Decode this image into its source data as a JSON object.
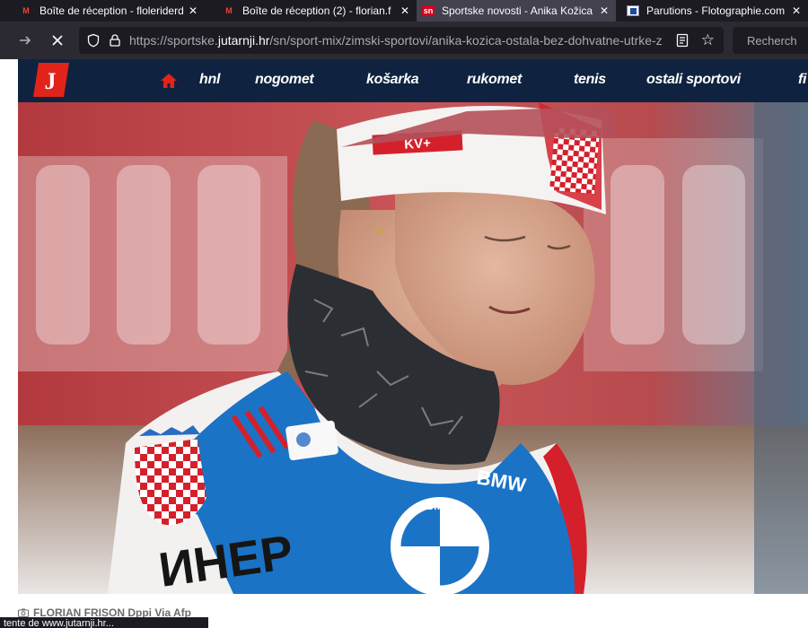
{
  "browser": {
    "tabs": [
      {
        "title": "Boîte de réception - floleriderdu",
        "favicon": "gmail-icon",
        "active": false
      },
      {
        "title": "Boîte de réception (2) - florian.f",
        "favicon": "gmail-icon",
        "active": false
      },
      {
        "title": "Sportske novosti - Anika Kožica",
        "favicon": "sn-icon",
        "favicon_text": "sn",
        "active": true
      },
      {
        "title": "Parutions - Flotographie.com",
        "favicon": "flotographie-icon",
        "active": false
      }
    ],
    "url_prefix": "https://sportske.",
    "url_domain": "jutarnji.hr",
    "url_path": "/sn/sport-mix/zimski-sportovi/anika-kozica-ostala-bez-dohvatne-utrke-z",
    "search_placeholder": "Recherch",
    "status_text": "tente de www.jutarnji.hr..."
  },
  "site": {
    "logo_text": "J",
    "nav": [
      "hnl",
      "nogomet",
      "košarka",
      "rukomet",
      "tenis",
      "ostali sportovi",
      "fi"
    ],
    "photo": {
      "bib_text": "ИHEP",
      "bmw_text": "BMW",
      "headband_text": "KV+"
    },
    "caption": "FLORIAN FRISON Dppi Via Afp"
  },
  "colors": {
    "tab_bg": "#1c1b22",
    "toolbar_bg": "#2b2a33",
    "site_nav_bg": "#0f2340",
    "brand_red": "#e2231a",
    "bib_blue": "#1b73c6"
  }
}
